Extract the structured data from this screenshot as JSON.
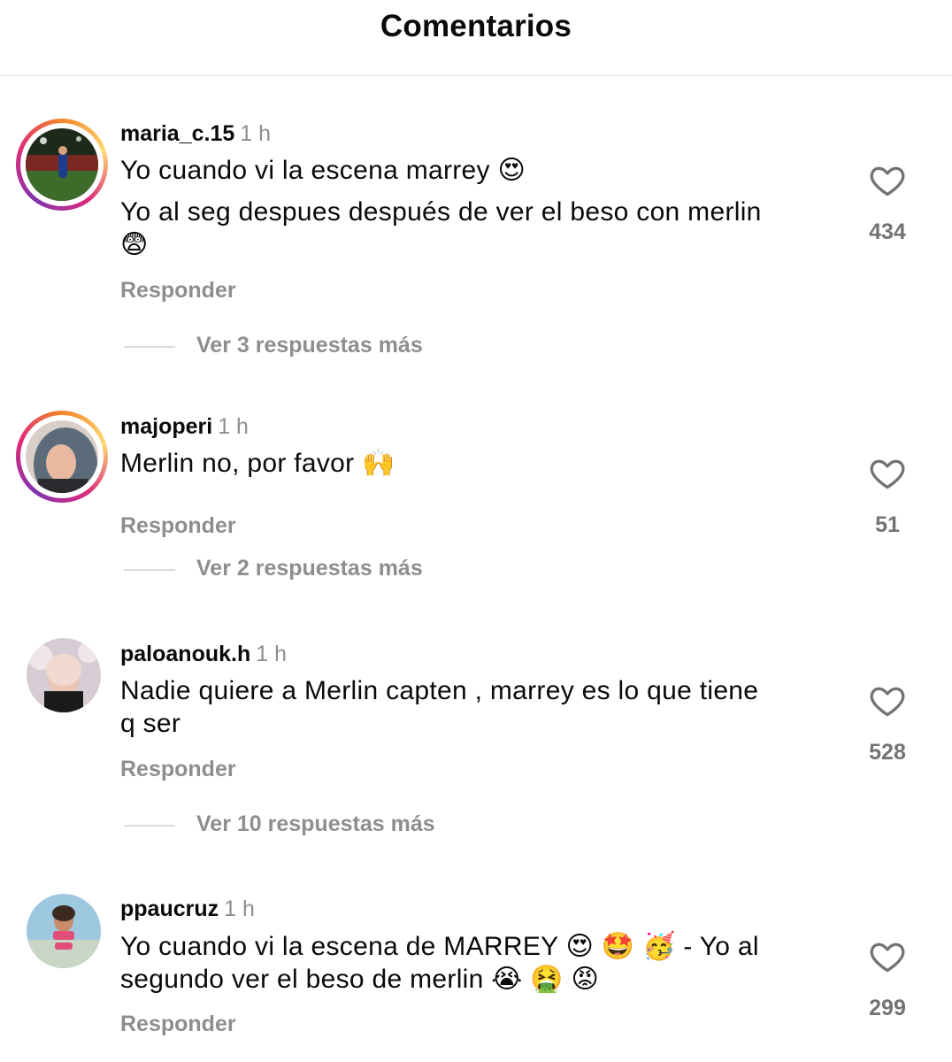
{
  "header": {
    "title": "Comentarios"
  },
  "comments": [
    {
      "username": "maria_c.15",
      "time": "1 h",
      "lines": [
        "Yo cuando vi la escena marrey 😍",
        "Yo al seg despues después de ver el beso con merlin",
        "😨"
      ],
      "reply_label": "Responder",
      "view_more": "Ver 3 respuestas más",
      "likes": "434"
    },
    {
      "username": "majoperi",
      "time": "1 h",
      "lines": [
        "Merlin no, por favor 🙌"
      ],
      "reply_label": "Responder",
      "view_more": "Ver 2 respuestas más",
      "likes": "51"
    },
    {
      "username": "paloanouk.h",
      "time": "1 h",
      "lines": [
        "Nadie quiere a Merlin capten , marrey es lo que tiene",
        "q ser"
      ],
      "reply_label": "Responder",
      "view_more": "Ver 10 respuestas más",
      "likes": "528"
    },
    {
      "username": "ppaucruz",
      "time": "1 h",
      "lines": [
        "Yo cuando vi la escena de MARREY 😍 🤩 🥳 - Yo al",
        "segundo ver el beso de merlin 😭 🤮 😡"
      ],
      "reply_label": "Responder",
      "likes": "299"
    }
  ],
  "icons": {
    "like": "heart-outline-icon"
  },
  "colors": {
    "ring_start": "#f58529",
    "ring_mid": "#dd2a7b",
    "ring_end": "#8134af",
    "muted": "#8e8e8e"
  }
}
